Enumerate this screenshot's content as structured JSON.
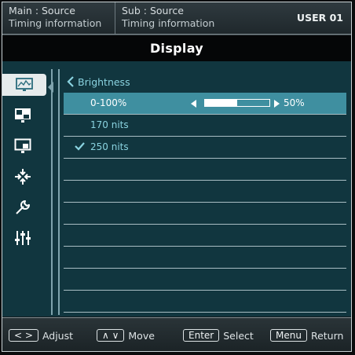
{
  "header": {
    "main_label": "Main : Source",
    "main_info": "Timing information",
    "sub_label": "Sub : Source",
    "sub_info": "Timing information",
    "user": "USER 01"
  },
  "title": "Display",
  "sidebar": {
    "items": [
      {
        "icon": "picture-icon",
        "selected": true
      },
      {
        "icon": "pip-icon",
        "selected": false
      },
      {
        "icon": "pbp-icon",
        "selected": false
      },
      {
        "icon": "arrange-icon",
        "selected": false
      },
      {
        "icon": "wrench-icon",
        "selected": false
      },
      {
        "icon": "equalizer-icon",
        "selected": false
      }
    ]
  },
  "submenu": {
    "back_label": "Brightness",
    "rows": [
      {
        "label": "0-100%",
        "selected": true,
        "value": "50%",
        "level": 0.5
      },
      {
        "label": "170 nits",
        "selected": false,
        "checked": false
      },
      {
        "label": "250 nits",
        "selected": false,
        "checked": true
      }
    ],
    "empty_rows": 7
  },
  "footer": {
    "adjust": {
      "key": "< >",
      "label": "Adjust"
    },
    "move": {
      "key": "∧ ∨",
      "label": "Move"
    },
    "select": {
      "key": "Enter",
      "label": "Select"
    },
    "return": {
      "key": "Menu",
      "label": "Return"
    }
  },
  "colors": {
    "content_bg": "#11363f",
    "selected_row": "#3f8fa0",
    "option_text": "#8ad3e0"
  }
}
